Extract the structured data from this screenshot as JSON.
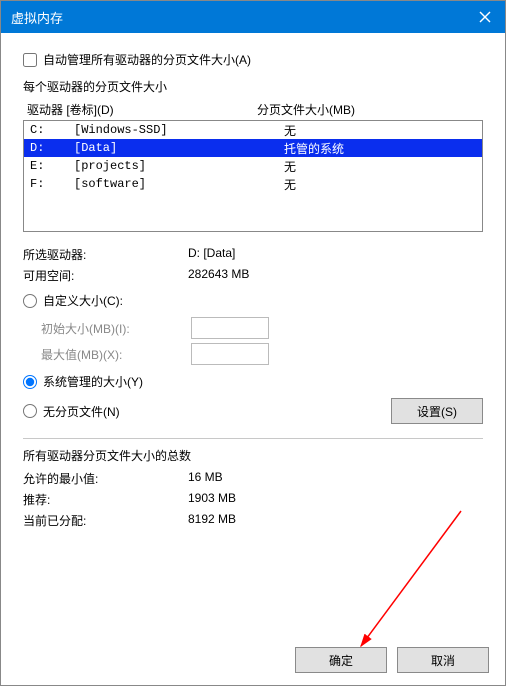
{
  "title": "虚拟内存",
  "auto_manage": {
    "label": "自动管理所有驱动器的分页文件大小(A)",
    "checked": false
  },
  "per_drive_label": "每个驱动器的分页文件大小",
  "list_headers": {
    "drive": "驱动器 [卷标](D)",
    "size": "分页文件大小(MB)"
  },
  "drives": [
    {
      "letter": "C:",
      "label": "[Windows-SSD]",
      "size": "无",
      "selected": false
    },
    {
      "letter": "D:",
      "label": "[Data]",
      "size": "托管的系统",
      "selected": true
    },
    {
      "letter": "E:",
      "label": "[projects]",
      "size": "无",
      "selected": false
    },
    {
      "letter": "F:",
      "label": "[software]",
      "size": "无",
      "selected": false
    }
  ],
  "selected_drive": {
    "label": "所选驱动器:",
    "value": "D:  [Data]"
  },
  "free_space": {
    "label": "可用空间:",
    "value": "282643 MB"
  },
  "custom": {
    "label": "自定义大小(C):",
    "selected": false
  },
  "initial": {
    "label": "初始大小(MB)(I):",
    "value": ""
  },
  "maximum": {
    "label": "最大值(MB)(X):",
    "value": ""
  },
  "system_managed": {
    "label": "系统管理的大小(Y)",
    "selected": true
  },
  "no_paging": {
    "label": "无分页文件(N)",
    "selected": false
  },
  "set_button": "设置(S)",
  "totals_label": "所有驱动器分页文件大小的总数",
  "totals": {
    "min": {
      "label": "允许的最小值:",
      "value": "16 MB"
    },
    "recommend": {
      "label": "推荐:",
      "value": "1903 MB"
    },
    "allocated": {
      "label": "当前已分配:",
      "value": "8192 MB"
    }
  },
  "ok_button": "确定",
  "cancel_button": "取消"
}
